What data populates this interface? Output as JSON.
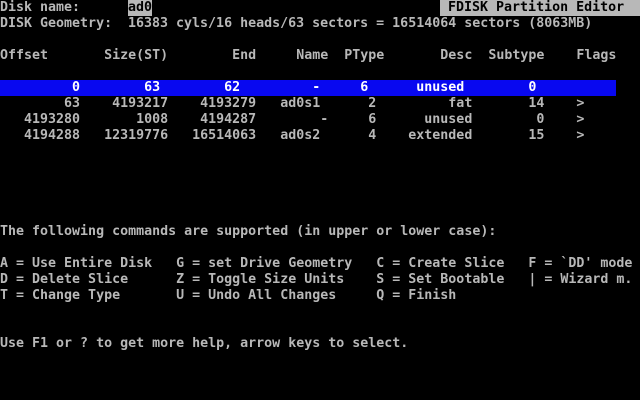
{
  "colors": {
    "screen_bg": "#000000",
    "text": "#b8b8b8",
    "inverse_bg": "#b8b8b8",
    "inverse_text": "#000000",
    "selected_bg": "#0808f0",
    "selected_text": "#ffffff"
  },
  "app": {
    "title": "FDISK Partition Editor",
    "disk_name_label": "Disk name:",
    "disk_name": "ad0",
    "geometry_label": "DISK Geometry:",
    "geometry": "16383 cyls/16 heads/63 sectors = 16514064 sectors (8063MB)"
  },
  "table": {
    "columns": [
      "Offset",
      "Size(ST)",
      "End",
      "Name",
      "PType",
      "Desc",
      "Subtype",
      "Flags"
    ],
    "partitions": [
      {
        "offset": "0",
        "size": "63",
        "end": "62",
        "name": "-",
        "ptype": "6",
        "desc": "unused",
        "subtype": "0",
        "flags": "",
        "selected": true
      },
      {
        "offset": "63",
        "size": "4193217",
        "end": "4193279",
        "name": "ad0s1",
        "ptype": "2",
        "desc": "fat",
        "subtype": "14",
        "flags": ">",
        "selected": false
      },
      {
        "offset": "4193280",
        "size": "1008",
        "end": "4194287",
        "name": "-",
        "ptype": "6",
        "desc": "unused",
        "subtype": "0",
        "flags": ">",
        "selected": false
      },
      {
        "offset": "4194288",
        "size": "12319776",
        "end": "16514063",
        "name": "ad0s2",
        "ptype": "4",
        "desc": "extended",
        "subtype": "15",
        "flags": ">",
        "selected": false
      }
    ]
  },
  "commands": {
    "intro": "The following commands are supported (in upper or lower case):",
    "items": [
      {
        "key": "A",
        "label": "Use Entire Disk"
      },
      {
        "key": "G",
        "label": "set Drive Geometry"
      },
      {
        "key": "C",
        "label": "Create Slice"
      },
      {
        "key": "F",
        "label": "`DD' mode"
      },
      {
        "key": "D",
        "label": "Delete Slice"
      },
      {
        "key": "Z",
        "label": "Toggle Size Units"
      },
      {
        "key": "S",
        "label": "Set Bootable"
      },
      {
        "key": "|",
        "label": "Wizard m."
      },
      {
        "key": "T",
        "label": "Change Type"
      },
      {
        "key": "U",
        "label": "Undo All Changes"
      },
      {
        "key": "Q",
        "label": "Finish"
      }
    ]
  },
  "help": "Use F1 or ? to get more help, arrow keys to select.",
  "screen": {
    "rows": [
      {
        "row": 0,
        "segments": [
          {
            "col": 0,
            "text": "Disk name:",
            "style": "normal",
            "name": "disk-name-label",
            "interactable": false
          },
          {
            "col": 16,
            "text": "ad0",
            "style": "inverse",
            "name": "disk-name-value",
            "interactable": false
          },
          {
            "col": 55,
            "text": " FDISK Partition Editor  ",
            "style": "inverse",
            "name": "page-title",
            "interactable": false
          }
        ]
      },
      {
        "row": 1,
        "segments": [
          {
            "col": 0,
            "text": "DISK Geometry:",
            "style": "normal",
            "name": "disk-geometry-label",
            "interactable": false
          },
          {
            "col": 16,
            "text": "16383 cyls/16 heads/63 sectors = 16514064 sectors (8063MB)",
            "style": "normal",
            "name": "disk-geometry-value",
            "interactable": false
          }
        ]
      },
      {
        "row": 3,
        "segments": [
          {
            "col": 0,
            "text": "Offset       Size(ST)        End     Name  PType       Desc  Subtype    Flags",
            "style": "normal",
            "name": "table-header",
            "interactable": false
          }
        ]
      },
      {
        "row": 5,
        "segments": [
          {
            "col": 0,
            "text": "         0        63        62         -     6      unused        0          ",
            "style": "selected",
            "name": "partition-row-selected",
            "interactable": true
          }
        ]
      },
      {
        "row": 6,
        "segments": [
          {
            "col": 0,
            "text": "        63    4193217    4193279   ad0s1      2         fat       14    >",
            "style": "normal",
            "name": "partition-row-ad0s1",
            "interactable": true
          }
        ]
      },
      {
        "row": 7,
        "segments": [
          {
            "col": 0,
            "text": "   4193280       1008    4194287        -     6      unused        0    >",
            "style": "normal",
            "name": "partition-row-unused",
            "interactable": true
          }
        ]
      },
      {
        "row": 8,
        "segments": [
          {
            "col": 0,
            "text": "   4194288   12319776   16514063   ad0s2      4    extended       15    >",
            "style": "normal",
            "name": "partition-row-ad0s2",
            "interactable": true
          }
        ]
      },
      {
        "row": 14,
        "segments": [
          {
            "col": 0,
            "text": "The following commands are supported (in upper or lower case):",
            "style": "normal",
            "name": "commands-intro",
            "interactable": false
          }
        ]
      },
      {
        "row": 16,
        "segments": [
          {
            "col": 0,
            "text": "A = Use Entire Disk   G = set Drive Geometry   C = Create Slice   F = `DD' mode",
            "style": "normal",
            "name": "commands-line-1",
            "interactable": false
          }
        ]
      },
      {
        "row": 17,
        "segments": [
          {
            "col": 0,
            "text": "D = Delete Slice      Z = Toggle Size Units    S = Set Bootable   | = Wizard m.",
            "style": "normal",
            "name": "commands-line-2",
            "interactable": false
          }
        ]
      },
      {
        "row": 18,
        "segments": [
          {
            "col": 0,
            "text": "T = Change Type       U = Undo All Changes     Q = Finish",
            "style": "normal",
            "name": "commands-line-3",
            "interactable": false
          }
        ]
      },
      {
        "row": 21,
        "segments": [
          {
            "col": 0,
            "text": "Use F1 or ? to get more help, arrow keys to select.",
            "style": "normal",
            "name": "help-line",
            "interactable": false
          }
        ]
      }
    ]
  }
}
